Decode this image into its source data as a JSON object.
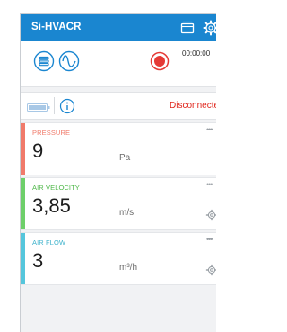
{
  "app": {
    "title": "Si-HVACR",
    "header_icons": [
      "window-icon",
      "gear-icon"
    ]
  },
  "toolbar": {
    "icons": [
      "list-icon",
      "waveform-icon",
      "record-icon"
    ],
    "timer": "00:00:00"
  },
  "status": {
    "icons": [
      "battery-icon",
      "info-icon"
    ],
    "connection": "Disconnected"
  },
  "measurements": [
    {
      "label": "PRESSURE",
      "value": "9",
      "unit": "Pa",
      "color": "#f07a6a",
      "menu": "•••"
    },
    {
      "label": "AIR VELOCITY",
      "value": "3,85",
      "unit": "m/s",
      "color": "#6ecf6a",
      "menu": "•••"
    },
    {
      "label": "AIR FLOW",
      "value": "3",
      "unit": "m³/h",
      "color": "#55c6dc",
      "menu": "•••"
    }
  ],
  "colors": {
    "primary": "#1a86d0",
    "disconnected": "#e0261c",
    "record": "#e53935"
  }
}
